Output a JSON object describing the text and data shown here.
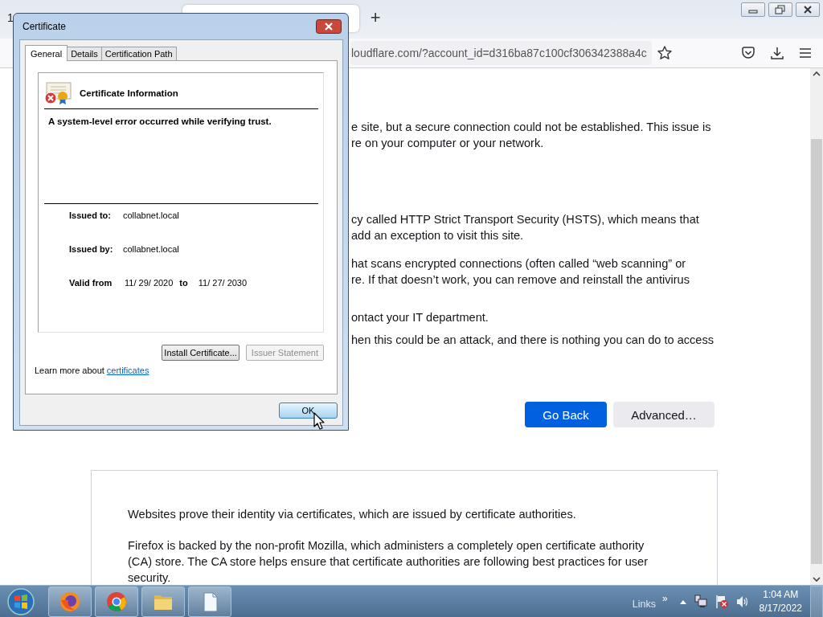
{
  "browser": {
    "tab_fragment": "1",
    "new_tab": "+",
    "address_bar": {
      "url": "loudflare.com/?account_id=d316ba87c100cf306342388a4c"
    }
  },
  "page": {
    "paragraphs": [
      [
        "e site, but a secure connection could not be established. This issue is",
        "re on your computer or your network."
      ],
      [
        "cy called HTTP Strict Transport Security (HSTS), which means that",
        "add an exception to visit this site."
      ],
      [
        "hat scans encrypted connections (often called “web scanning” or",
        "re. If that doesn’t work, you can remove and reinstall the antivirus"
      ],
      [
        "ontact your IT department."
      ],
      [
        "hen this could be an attack, and there is nothing you can do to access"
      ]
    ],
    "buttons": [
      {
        "label": "Go Back",
        "kind": "primary"
      },
      {
        "label": "Advanced…",
        "kind": "secondary"
      }
    ],
    "info_box": {
      "paragraphs": [
        "Websites prove their identity via certificates, which are issued by certificate authorities.",
        "Firefox is backed by the non-profit Mozilla, which administers a completely open certificate authority (CA) store. The CA store helps ensure that certificate authorities are following best practices for user security."
      ]
    }
  },
  "dialog": {
    "title": "Certificate",
    "tabs": [
      {
        "label": "General",
        "selected": true
      },
      {
        "label": "Details",
        "selected": false
      },
      {
        "label": "Certification Path",
        "selected": false
      }
    ],
    "heading": "Certificate Information",
    "message": "A system-level error occurred while verifying trust.",
    "fields": [
      {
        "label": "Issued to:",
        "value": "collabnet.local"
      },
      {
        "label": "Issued by:",
        "value": "collabnet.local"
      }
    ],
    "validity": {
      "label": "Valid from",
      "from": "11/ 29/ 2020",
      "to_label": "to",
      "to": "11/ 27/ 2030"
    },
    "buttons": [
      {
        "label": "Install Certificate...",
        "disabled": false
      },
      {
        "label": "Issuer Statement",
        "disabled": true
      }
    ],
    "learn_more": {
      "text": "Learn more about",
      "link": "certificates"
    },
    "ok": "OK"
  },
  "taskbar": {
    "links": "Links",
    "chevron": "»",
    "time": "1:04 AM",
    "date": "8/17/2022"
  }
}
